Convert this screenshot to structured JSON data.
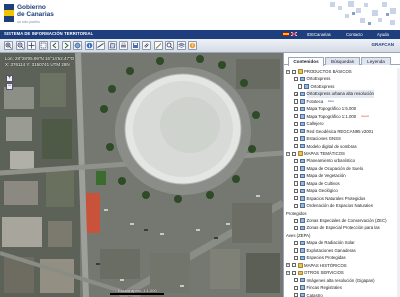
{
  "header": {
    "brand_line1": "Gobierno",
    "brand_line2": "de Canarias",
    "brand_sub": "un solo pueblo"
  },
  "nav": {
    "title": "SISTEMA DE INFORMACIÓN TERRITORIAL",
    "links": [
      "IDECanarias",
      "Contacto",
      "Ayuda"
    ]
  },
  "toolbar": {
    "brand": "GRAFCAN"
  },
  "map": {
    "coords_line1": "Lon: 28°28'05.99\"N 16°14'52.47\"O",
    "coords_line2": "X: 376114  Y: 3150741  UTM 28N",
    "scale_label": "Escala aprox. 1:1.000",
    "zoom_in": "+",
    "zoom_out": "−"
  },
  "panel": {
    "tabs": [
      "Contenidos",
      "Búsquedas",
      "Leyenda"
    ],
    "active_tab": "Contenidos",
    "rows": [
      {
        "label": "PRODUCTOS BÁSICOS",
        "type": "folder",
        "level": 0,
        "expanded": true,
        "checked": false
      },
      {
        "label": "OrtoExpress",
        "type": "layer",
        "level": 1,
        "checked": false
      },
      {
        "label": "OrtoExpress",
        "type": "layer",
        "level": 2,
        "checked": false
      },
      {
        "label": "OrtoExpress urbana alta resolución",
        "type": "layer",
        "level": 1,
        "checked": true,
        "selected": true
      },
      {
        "label": "Fototeca",
        "type": "layer",
        "level": 1,
        "checked": false,
        "tag": "beta",
        "tag_color": "blue"
      },
      {
        "label": "Mapa Topográfico 1:5.000",
        "type": "layer",
        "level": 1,
        "checked": false
      },
      {
        "label": "Mapa Topográfico 1:1.000",
        "type": "layer",
        "level": 1,
        "checked": false,
        "tag": "nuevo",
        "tag_color": "red"
      },
      {
        "label": "Callejero",
        "type": "layer",
        "level": 1,
        "checked": false
      },
      {
        "label": "Red Geodésica REGCAN95 v2001",
        "type": "layer",
        "level": 1,
        "checked": false
      },
      {
        "label": "Estaciones GNSS",
        "type": "layer",
        "level": 1,
        "checked": false
      },
      {
        "label": "Modelo digital de sombras",
        "type": "layer",
        "level": 1,
        "checked": false
      },
      {
        "label": "MAPAS TEMÁTICOS",
        "type": "folder",
        "level": 0,
        "expanded": true,
        "checked": false
      },
      {
        "label": "Planeamiento urbanístico",
        "type": "layer",
        "level": 1,
        "checked": false
      },
      {
        "label": "Mapa de Ocupación de Suelo",
        "type": "layer",
        "level": 1,
        "checked": false
      },
      {
        "label": "Mapa de Vegetación",
        "type": "layer",
        "level": 1,
        "checked": false
      },
      {
        "label": "Mapa de Cultivos",
        "type": "layer",
        "level": 1,
        "checked": false
      },
      {
        "label": "Mapa Geológico",
        "type": "layer",
        "level": 1,
        "checked": false
      },
      {
        "label": "Espacios Naturales Protegidos",
        "type": "layer",
        "level": 1,
        "checked": false
      },
      {
        "label": "Ordenación de Espacios Naturales",
        "type": "layer",
        "level": 1,
        "checked": false
      },
      {
        "label": "Protegidos",
        "type": "text",
        "level": 0
      },
      {
        "label": "Zonas Especiales de Conservación (ZEC)",
        "type": "layer",
        "level": 1,
        "checked": false
      },
      {
        "label": "Zonas de Especial Protección para las",
        "type": "layer",
        "level": 1,
        "checked": false
      },
      {
        "label": "Aves (ZEPA)",
        "type": "text",
        "level": 0
      },
      {
        "label": "Mapa de Radiación Solar",
        "type": "layer",
        "level": 1,
        "checked": false
      },
      {
        "label": "Explotaciones Ganaderas",
        "type": "layer",
        "level": 1,
        "checked": false
      },
      {
        "label": "Especies Protegidas",
        "type": "layer",
        "level": 1,
        "checked": false
      },
      {
        "label": "MAPAS HISTÓRICOS",
        "type": "folder",
        "level": 0,
        "expanded": false,
        "checked": false
      },
      {
        "label": "OTROS SERVICIOS",
        "type": "folder",
        "level": 0,
        "expanded": true,
        "checked": false
      },
      {
        "label": "Imágenes alta resolución (Gigapan)",
        "type": "layer",
        "level": 1,
        "checked": false
      },
      {
        "label": "Fincas Registrales",
        "type": "layer",
        "level": 1,
        "checked": false
      },
      {
        "label": "Catastro",
        "type": "layer",
        "level": 1,
        "checked": false
      }
    ]
  },
  "colors": {
    "nav_bar": "#1e3e7e",
    "brand_blue": "#1d3f7a",
    "folder": "#e8c455",
    "new_tag": "#d23a2a",
    "beta_tag": "#2a56b7"
  },
  "icons": {
    "toolbar": [
      "zoom-in-icon",
      "zoom-out-icon",
      "pan-icon",
      "zoom-box-icon",
      "back-icon",
      "forward-icon",
      "full-extent-icon",
      "info-icon",
      "measure-distance-icon",
      "measure-area-icon",
      "print-icon",
      "save-icon",
      "link-icon",
      "draw-icon",
      "search-icon",
      "layers-icon",
      "help-icon"
    ]
  }
}
